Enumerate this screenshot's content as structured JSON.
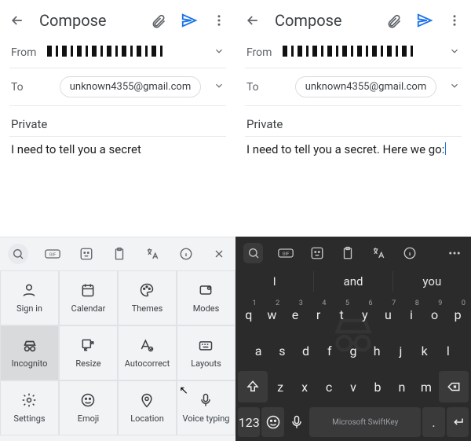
{
  "left": {
    "header": {
      "title": "Compose"
    },
    "from_label": "From",
    "to_label": "To",
    "to_chip": "unknown4355@gmail.com",
    "subject": "Private",
    "body": "I need to tell you a secret",
    "keyboard": {
      "toolbar": [
        "search",
        "gif",
        "sticker",
        "clipboard",
        "translate",
        "info",
        "close"
      ],
      "grid": [
        {
          "icon": "signin",
          "label": "Sign in"
        },
        {
          "icon": "calendar",
          "label": "Calendar"
        },
        {
          "icon": "themes",
          "label": "Themes"
        },
        {
          "icon": "modes",
          "label": "Modes"
        },
        {
          "icon": "incognito",
          "label": "Incognito",
          "selected": true
        },
        {
          "icon": "resize",
          "label": "Resize"
        },
        {
          "icon": "autocorrect",
          "label": "Autocorrect"
        },
        {
          "icon": "layouts",
          "label": "Layouts"
        },
        {
          "icon": "settings",
          "label": "Settings"
        },
        {
          "icon": "emoji",
          "label": "Emoji"
        },
        {
          "icon": "location",
          "label": "Location"
        },
        {
          "icon": "voice",
          "label": "Voice typing"
        }
      ]
    }
  },
  "right": {
    "header": {
      "title": "Compose"
    },
    "from_label": "From",
    "to_label": "To",
    "to_chip": "unknown4355@gmail.com",
    "subject": "Private",
    "body": "I need to tell you a secret. Here we go:",
    "keyboard": {
      "toolbar": [
        "search",
        "gif",
        "sticker",
        "clipboard",
        "translate",
        "info",
        "more"
      ],
      "suggestions": [
        "I",
        "and",
        "you"
      ],
      "row1_nums": [
        "1",
        "2",
        "3",
        "4",
        "5",
        "6",
        "7",
        "8",
        "9",
        "0"
      ],
      "row1": [
        "q",
        "w",
        "e",
        "r",
        "t",
        "y",
        "u",
        "i",
        "o",
        "p"
      ],
      "row2": [
        "a",
        "s",
        "d",
        "f",
        "g",
        "h",
        "j",
        "k",
        "l"
      ],
      "row3": [
        "z",
        "x",
        "c",
        "v",
        "b",
        "n",
        "m"
      ],
      "row4": {
        "num": "123",
        "space": "Microsoft SwiftKey"
      }
    }
  }
}
